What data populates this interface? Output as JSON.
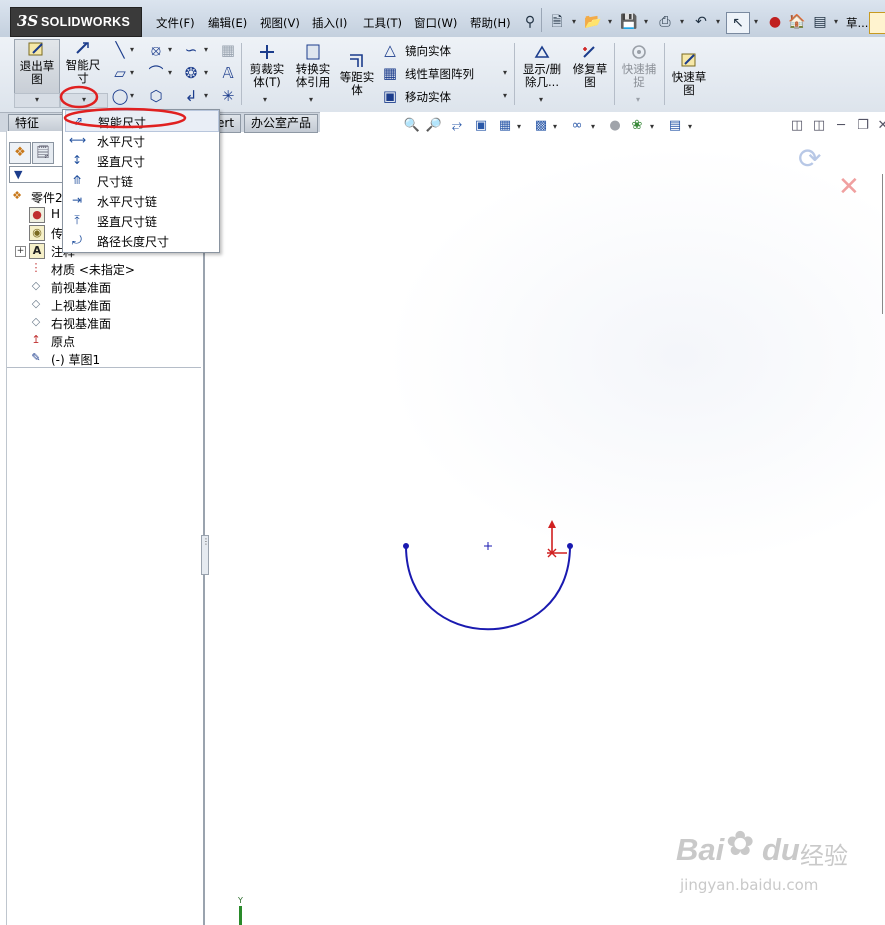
{
  "app": {
    "logo_ds": "3S",
    "logo_text": "SOLIDWORKS"
  },
  "menu": [
    "文件(F)",
    "编辑(E)",
    "视图(V)",
    "插入(I)",
    "工具(T)",
    "窗口(W)",
    "帮助(H)"
  ],
  "title_right": "草...",
  "toolbar": {
    "exit_sketch": [
      "退出草",
      "图"
    ],
    "smart_dim": [
      "智能尺",
      "寸"
    ],
    "trim": [
      "剪裁实",
      "体(T)"
    ],
    "convert": [
      "转换实",
      "体引用"
    ],
    "offset": [
      "等距实",
      "体"
    ],
    "mirror": "镜向实体",
    "linear_pattern": "线性草图阵列",
    "move": "移动实体",
    "show_delete": [
      "显示/删",
      "除几..."
    ],
    "repair": [
      "修复草",
      "图"
    ],
    "quick_snap": [
      "快速捕",
      "捉"
    ],
    "quick_sketch": [
      "快速草",
      "图"
    ]
  },
  "tabs": [
    "特征",
    "ert",
    "办公室产品"
  ],
  "tree": {
    "root": "零件2",
    "history": "H",
    "sensors": "传",
    "annotations": "注释",
    "material": "材质 <未指定>",
    "front": "前视基准面",
    "top": "上视基准面",
    "right": "右视基准面",
    "origin": "原点",
    "sketch": "(-) 草图1"
  },
  "dimension_menu": [
    {
      "label": "智能尺寸",
      "icon": "smart-dimension-icon"
    },
    {
      "label": "水平尺寸",
      "icon": "horizontal-dimension-icon"
    },
    {
      "label": "竖直尺寸",
      "icon": "vertical-dimension-icon"
    },
    {
      "label": "尺寸链",
      "icon": "ordinate-dimension-icon"
    },
    {
      "label": "水平尺寸链",
      "icon": "horizontal-ordinate-icon"
    },
    {
      "label": "竖直尺寸链",
      "icon": "vertical-ordinate-icon"
    },
    {
      "label": "路径长度尺寸",
      "icon": "path-length-icon"
    }
  ],
  "axis_label": "Y",
  "watermark": {
    "brand": "Bai",
    "brand2": "du",
    "cn": "经验",
    "url": "jingyan.baidu.com"
  },
  "colors": {
    "sketch_line": "#1a1ab0",
    "highlight": "#e02020",
    "accent": "#2a58a8"
  }
}
